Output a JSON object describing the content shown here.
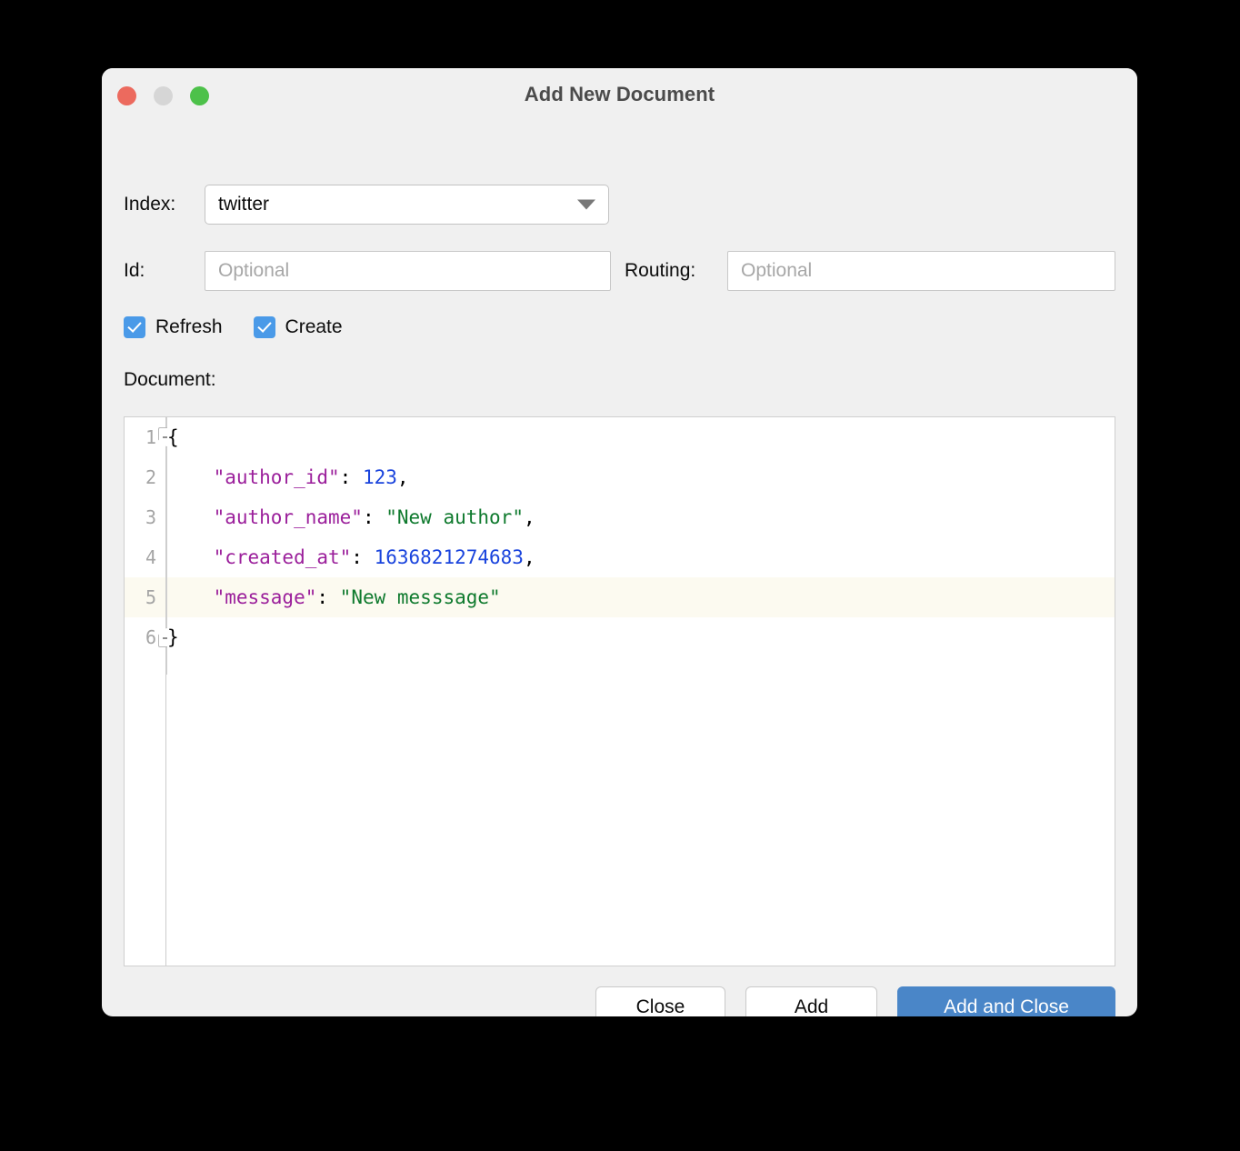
{
  "window": {
    "title": "Add New Document",
    "traffic_lights": [
      {
        "name": "close",
        "color": "#ec6a5e"
      },
      {
        "name": "minimize",
        "color": "#d6d6d6"
      },
      {
        "name": "maximize",
        "color": "#4dc14a"
      }
    ]
  },
  "form": {
    "index": {
      "label": "Index:",
      "value": "twitter",
      "arrow_icon": "chevron-down-icon"
    },
    "id": {
      "label": "Id:",
      "value": "",
      "placeholder": "Optional"
    },
    "routing": {
      "label": "Routing:",
      "value": "",
      "placeholder": "Optional"
    },
    "checkboxes": [
      {
        "label": "Refresh",
        "checked": true
      },
      {
        "label": "Create",
        "checked": true
      }
    ],
    "document_label": "Document:"
  },
  "editor": {
    "highlighted_line": 5,
    "line_numbers": [
      "1",
      "2",
      "3",
      "4",
      "5",
      "6"
    ],
    "lines": [
      {
        "n": "1",
        "text": "{",
        "fold": "open"
      },
      {
        "n": "2",
        "text": "    \"author_id\": 123,",
        "fold": null
      },
      {
        "n": "3",
        "text": "    \"author_name\": \"New author\",",
        "fold": null
      },
      {
        "n": "4",
        "text": "    \"created_at\": 1636821274683,",
        "fold": null
      },
      {
        "n": "5",
        "text": "    \"message\": \"New messsage\"",
        "fold": null
      },
      {
        "n": "6",
        "text": "}",
        "fold": "close"
      }
    ],
    "tokens": {
      "line1": {
        "brace": "{"
      },
      "line2": {
        "key": "\"author_id\"",
        "colon": ": ",
        "value": "123",
        "comma": ","
      },
      "line3": {
        "key": "\"author_name\"",
        "colon": ": ",
        "value": "\"New author\"",
        "comma": ","
      },
      "line4": {
        "key": "\"created_at\"",
        "colon": ": ",
        "value": "1636821274683",
        "comma": ","
      },
      "line5": {
        "key": "\"message\"",
        "colon": ": ",
        "value": "\"New messsage\"",
        "comma": ""
      },
      "line6": {
        "brace": "}"
      }
    },
    "colors": {
      "key": "#9b1f9b",
      "string": "#0f7a2e",
      "number": "#1a44dd",
      "punctuation": "#000000",
      "highlight_row": "#fcfaf0"
    }
  },
  "footer": {
    "close_label": "Close",
    "add_label": "Add",
    "add_and_close_label": "Add and Close",
    "primary_color": "#4a86c8"
  }
}
